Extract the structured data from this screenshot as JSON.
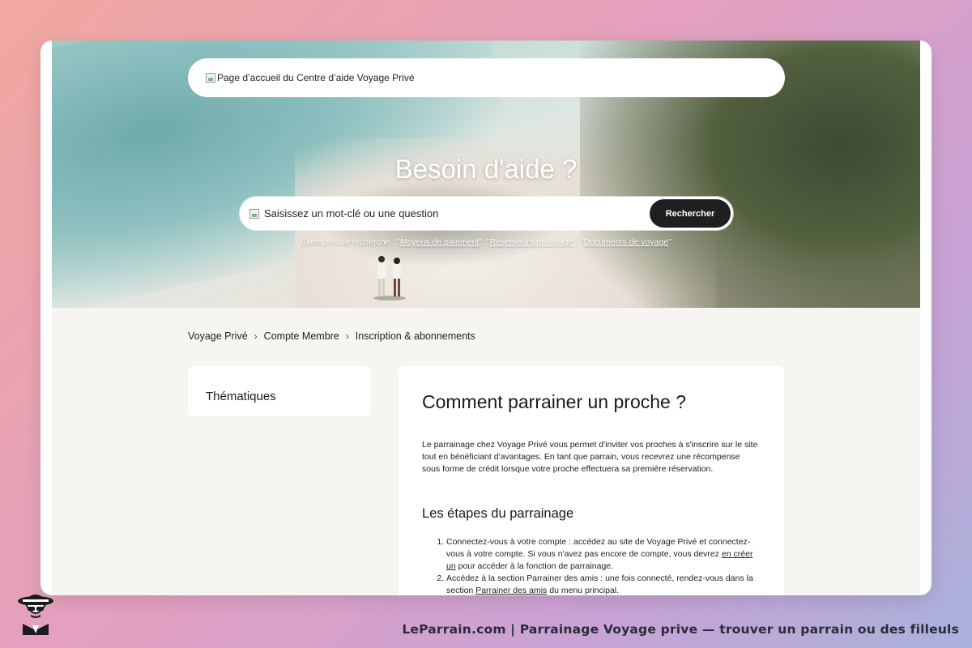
{
  "header": {
    "logo_alt": "Page d’accueil du Centre d’aide Voyage Privé"
  },
  "hero": {
    "title": "Besoin d'aide ?",
    "search": {
      "placeholder": "Saisissez un mot-clé ou une question",
      "button_label": "Rechercher"
    },
    "examples": {
      "prefix": "Exemples de recherche : \"",
      "items": [
        "Moyens de paiement",
        "Réserver mon voyage",
        "Documents de voyage"
      ],
      "sep1": "\", \"",
      "sep2": "\", \"",
      "suffix": "\""
    }
  },
  "breadcrumb": {
    "items": [
      "Voyage Privé",
      "Compte Membre",
      "Inscription & abonnements"
    ]
  },
  "sidebar": {
    "title": "Thématiques"
  },
  "article": {
    "title": "Comment parrainer un proche ?",
    "intro": "Le parrainage chez Voyage Privé vous permet d'inviter vos proches à s'inscrire sur le site tout en bénéficiant d'avantages. En tant que parrain, vous recevrez une récompense sous forme de crédit lorsque votre proche effectuera sa première réservation.",
    "section_title": "Les étapes du parrainage",
    "steps": [
      {
        "text_before": "Connectez-vous à votre compte : accédez au site de Voyage Privé et connectez-vous à votre compte. Si vous n'avez pas encore de compte, vous devrez ",
        "link": "en créer un",
        "text_after": " pour accéder à la fonction de parrainage."
      },
      {
        "text_before": "Accédez à la section Parrainer des amis : une fois connecté, rendez-vous dans la section ",
        "link": "Parrainer des amis",
        "text_after": " du menu principal."
      }
    ]
  },
  "footer": {
    "caption": "LeParrain.com | Parrainage Voyage prive — trouver un parrain ou des filleuls"
  }
}
